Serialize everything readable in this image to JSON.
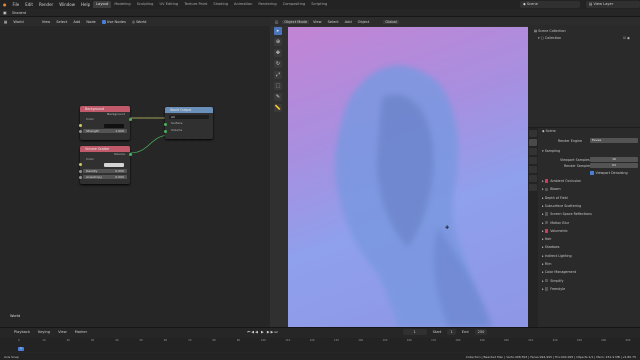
{
  "menu": [
    "File",
    "Edit",
    "Render",
    "Window",
    "Help"
  ],
  "workspaces": [
    "Layout",
    "Modeling",
    "Sculpting",
    "UV Editing",
    "Texture Paint",
    "Shading",
    "Animation",
    "Rendering",
    "Compositing",
    "Scripting"
  ],
  "scene_field": "Scene",
  "view_layer_field": "View Layer",
  "secondary_bar": "Shaderd",
  "node_editor": {
    "header": [
      "World",
      "View",
      "Select",
      "Add",
      "Node"
    ],
    "use_nodes": "Use Nodes",
    "world_name": "World",
    "nodes": {
      "background": {
        "title": "Background",
        "out": "Background",
        "color_label": "Color",
        "strength_label": "Strength",
        "strength_value": "1.000"
      },
      "volume": {
        "title": "Volume Scatter",
        "out": "Volume",
        "color_label": "Color",
        "density_label": "Density",
        "density_value": "0.000",
        "aniso_label": "Anisotropy",
        "aniso_value": "0.000"
      },
      "output": {
        "title": "World Output",
        "target": "All",
        "surface_label": "Surface",
        "volume_label": "Volume"
      }
    },
    "world_label": "World"
  },
  "viewport": {
    "header": [
      "Object Mode",
      "View",
      "Select",
      "Add",
      "Object"
    ],
    "transform": "Global"
  },
  "outliner": {
    "header_label": "Scene Collection",
    "items": [
      "Scene Collection",
      "Collection"
    ]
  },
  "properties": {
    "scene_label": "Scene",
    "render_engine_label": "Render Engine",
    "render_engine_value": "Eevee",
    "sampling_label": "Sampling",
    "viewport_samples_label": "Viewport Samples",
    "viewport_samples": "16",
    "render_samples_label": "Render Samples",
    "render_samples": "64",
    "viewport_denoising": "Viewport Denoising",
    "sections": [
      {
        "label": "Ambient Occlusion",
        "check": true
      },
      {
        "label": "Bloom",
        "check": false
      },
      {
        "label": "Depth of Field",
        "check": null
      },
      {
        "label": "Subsurface Scattering",
        "check": null
      },
      {
        "label": "Screen Space Reflections",
        "check": false
      },
      {
        "label": "Motion Blur",
        "check": false
      },
      {
        "label": "Volumetric",
        "check": true
      },
      {
        "label": "Hair",
        "check": null
      },
      {
        "label": "Shadows",
        "check": null
      },
      {
        "label": "Indirect Lighting",
        "check": null
      },
      {
        "label": "Film",
        "check": null
      },
      {
        "label": "Color Management",
        "check": null
      },
      {
        "label": "Simplify",
        "check": false
      },
      {
        "label": "Freestyle",
        "check": false
      }
    ]
  },
  "timeline": {
    "header": [
      "Playback",
      "Keying",
      "View",
      "Marker"
    ],
    "frame": "1",
    "start_label": "Start",
    "start": "1",
    "end_label": "End",
    "end": "250",
    "current_frame": "1",
    "ticks": [
      "0",
      "10",
      "20",
      "30",
      "40",
      "50",
      "60",
      "70",
      "80",
      "90",
      "100",
      "110",
      "120",
      "130",
      "140",
      "150",
      "160",
      "170",
      "180",
      "190",
      "200",
      "210",
      "220",
      "230",
      "240",
      "250"
    ]
  },
  "status": {
    "left": "Axis Snap",
    "right": "Collection | Bearded Man | Verts:498,593 | Faces:994,995 | Tris:994,995 | Objects:1/1 | Mem: 251.9 MB | v2.80.75"
  }
}
